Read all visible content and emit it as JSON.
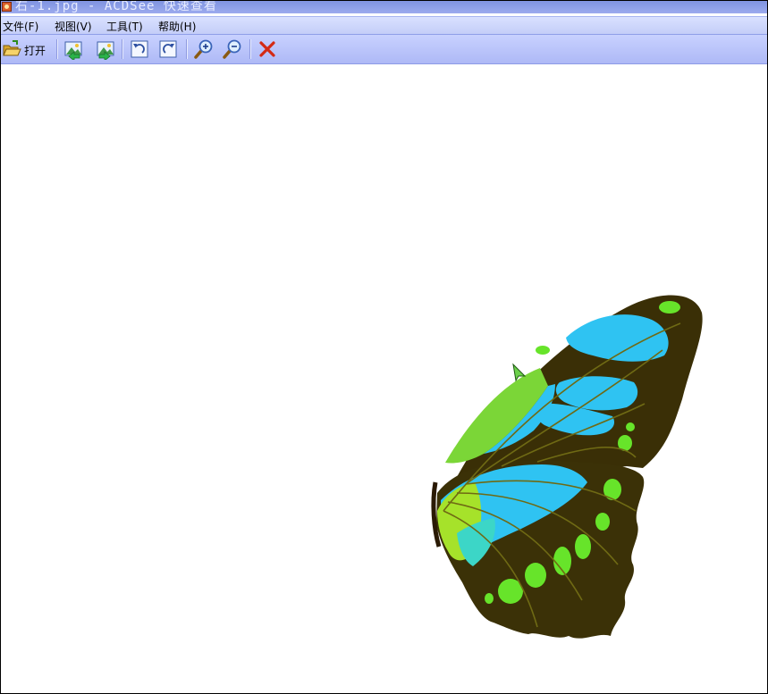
{
  "window": {
    "title": "右-1.jpg - ACDSee 快速查看"
  },
  "menu": {
    "items": [
      {
        "label": "文件(F)"
      },
      {
        "label": "视图(V)"
      },
      {
        "label": "工具(T)"
      },
      {
        "label": "帮助(H)"
      }
    ]
  },
  "toolbar": {
    "open_label": "打开",
    "buttons": [
      {
        "icon": "folder-open-icon"
      },
      {
        "icon": "previous-image-icon"
      },
      {
        "icon": "next-image-icon"
      },
      {
        "icon": "rotate-left-icon"
      },
      {
        "icon": "rotate-right-icon"
      },
      {
        "icon": "zoom-in-icon"
      },
      {
        "icon": "zoom-out-icon"
      },
      {
        "icon": "close-icon"
      }
    ]
  },
  "image": {
    "subject": "butterfly wing",
    "colors": {
      "wing_dark": "#3a2f06",
      "cyan": "#2fc3f2",
      "green": "#67e42a",
      "vein": "#6f6a14"
    }
  },
  "colors": {
    "title_bar": "#8f9fe8",
    "menu_bar": "#cdd5fb",
    "toolbar": "#b8c2f8",
    "close_red": "#d42a14"
  }
}
